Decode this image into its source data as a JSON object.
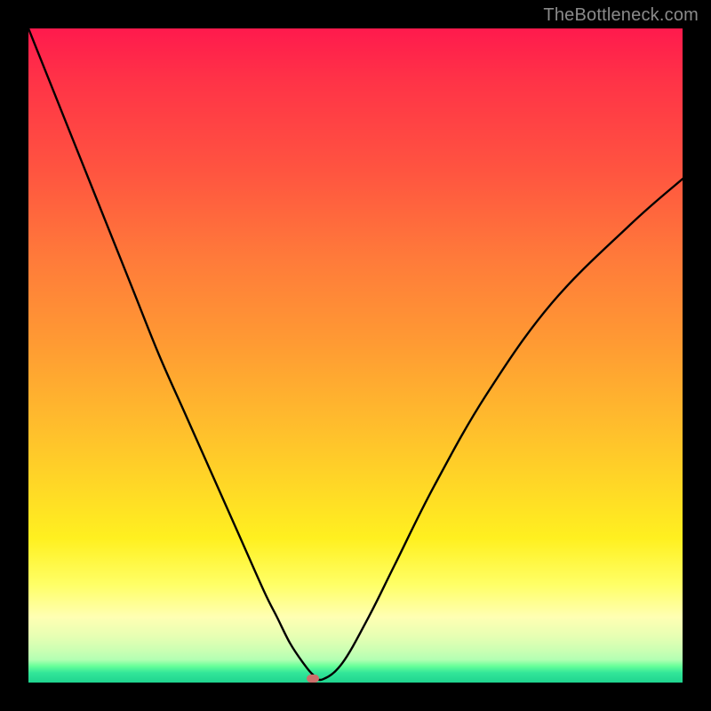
{
  "watermark": "TheBottleneck.com",
  "chart_data": {
    "type": "line",
    "title": "",
    "xlabel": "",
    "ylabel": "",
    "xlim": [
      0,
      100
    ],
    "ylim": [
      0,
      100
    ],
    "grid": false,
    "legend": false,
    "series": [
      {
        "name": "bottleneck-curve",
        "x": [
          0,
          4,
          8,
          12,
          16,
          20,
          24,
          28,
          32,
          36,
          38,
          40,
          42,
          43.5,
          45,
          48,
          52,
          56,
          62,
          70,
          80,
          92,
          100
        ],
        "y": [
          100,
          90,
          80,
          70,
          60,
          50,
          41,
          32,
          23,
          14,
          10,
          6,
          3,
          1.2,
          0.5,
          3,
          10,
          18,
          30,
          44,
          58,
          70,
          77
        ]
      }
    ],
    "marker": {
      "x": 43.5,
      "y": 0.5,
      "color": "#cc6f6b"
    },
    "background_gradient_stops": [
      {
        "pct": 0,
        "color": "#ff1a4d"
      },
      {
        "pct": 22,
        "color": "#ff5540"
      },
      {
        "pct": 48,
        "color": "#ff9a33"
      },
      {
        "pct": 70,
        "color": "#ffd826"
      },
      {
        "pct": 85,
        "color": "#ffff66"
      },
      {
        "pct": 95,
        "color": "#ccffb3"
      },
      {
        "pct": 100,
        "color": "#1fd48f"
      }
    ]
  }
}
